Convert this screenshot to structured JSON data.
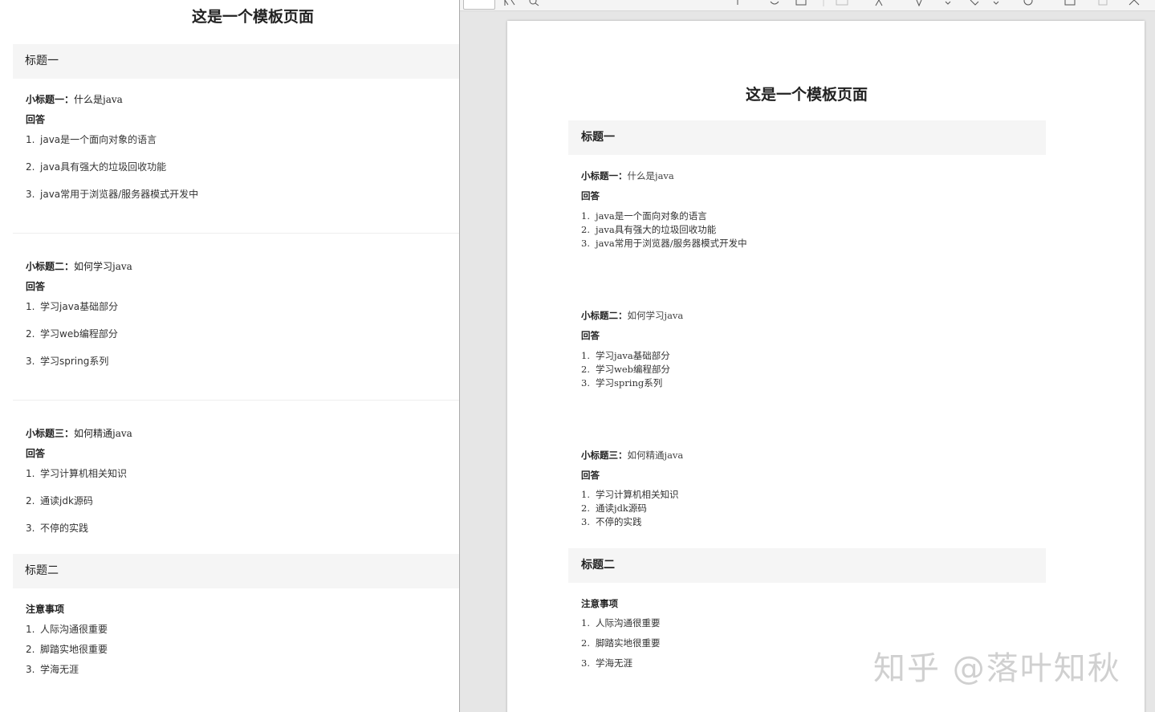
{
  "left_preview": {
    "title": "这是一个模板页面",
    "heading1": "标题一",
    "sections": [
      {
        "label": "小标题一：",
        "question": "什么是java",
        "answer_label": "回答",
        "items": [
          "java是一个面向对象的语言",
          "java具有强大的垃圾回收功能",
          "java常用于浏览器/服务器模式开发中"
        ]
      },
      {
        "label": "小标题二：",
        "question": "如何学习java",
        "answer_label": "回答",
        "items": [
          "学习java基础部分",
          "学习web编程部分",
          "学习spring系列"
        ]
      },
      {
        "label": "小标题三：",
        "question": "如何精通java",
        "answer_label": "回答",
        "items": [
          "学习计算机相关知识",
          "通读jdk源码",
          "不停的实践"
        ]
      }
    ],
    "heading2": "标题二",
    "notes_label": "注意事项",
    "notes": [
      "人际沟通很重要",
      "脚踏实地很重要",
      "学海无涯"
    ]
  },
  "pdf_page": {
    "title": "这是一个模板页面",
    "heading1": "标题一",
    "sections": [
      {
        "label": "小标题一：",
        "question": "什么是java",
        "answer_label": "回答",
        "items": [
          "java是一个面向对象的语言",
          "java具有强大的垃圾回收功能",
          "java常用于浏览器/服务器模式开发中"
        ]
      },
      {
        "label": "小标题二：",
        "question": "如何学习java",
        "answer_label": "回答",
        "items": [
          "学习java基础部分",
          "学习web编程部分",
          "学习spring系列"
        ]
      },
      {
        "label": "小标题三：",
        "question": "如何精通java",
        "answer_label": "回答",
        "items": [
          "学习计算机相关知识",
          "通读jdk源码",
          "不停的实践"
        ]
      }
    ],
    "heading2": "标题二",
    "notes_label": "注意事项",
    "notes": [
      "人际沟通很重要",
      "脚踏实地很重要",
      "学海无涯"
    ]
  },
  "numbers": [
    "1.",
    "2.",
    "3."
  ],
  "watermark": "知乎 @落叶知秋"
}
